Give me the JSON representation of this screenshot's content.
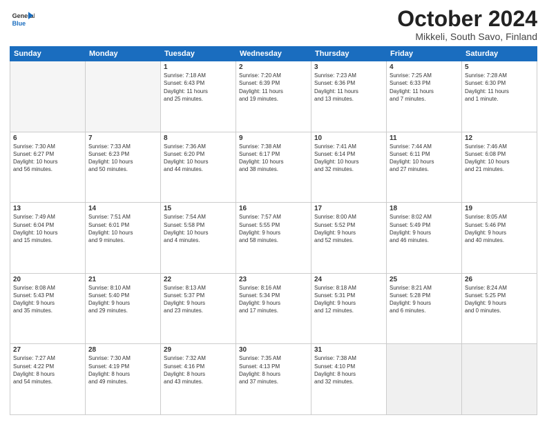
{
  "logo": {
    "line1": "General",
    "line2": "Blue"
  },
  "title": "October 2024",
  "subtitle": "Mikkeli, South Savo, Finland",
  "weekdays": [
    "Sunday",
    "Monday",
    "Tuesday",
    "Wednesday",
    "Thursday",
    "Friday",
    "Saturday"
  ],
  "weeks": [
    [
      {
        "day": "",
        "detail": ""
      },
      {
        "day": "",
        "detail": ""
      },
      {
        "day": "1",
        "detail": "Sunrise: 7:18 AM\nSunset: 6:43 PM\nDaylight: 11 hours\nand 25 minutes."
      },
      {
        "day": "2",
        "detail": "Sunrise: 7:20 AM\nSunset: 6:39 PM\nDaylight: 11 hours\nand 19 minutes."
      },
      {
        "day": "3",
        "detail": "Sunrise: 7:23 AM\nSunset: 6:36 PM\nDaylight: 11 hours\nand 13 minutes."
      },
      {
        "day": "4",
        "detail": "Sunrise: 7:25 AM\nSunset: 6:33 PM\nDaylight: 11 hours\nand 7 minutes."
      },
      {
        "day": "5",
        "detail": "Sunrise: 7:28 AM\nSunset: 6:30 PM\nDaylight: 11 hours\nand 1 minute."
      }
    ],
    [
      {
        "day": "6",
        "detail": "Sunrise: 7:30 AM\nSunset: 6:27 PM\nDaylight: 10 hours\nand 56 minutes."
      },
      {
        "day": "7",
        "detail": "Sunrise: 7:33 AM\nSunset: 6:23 PM\nDaylight: 10 hours\nand 50 minutes."
      },
      {
        "day": "8",
        "detail": "Sunrise: 7:36 AM\nSunset: 6:20 PM\nDaylight: 10 hours\nand 44 minutes."
      },
      {
        "day": "9",
        "detail": "Sunrise: 7:38 AM\nSunset: 6:17 PM\nDaylight: 10 hours\nand 38 minutes."
      },
      {
        "day": "10",
        "detail": "Sunrise: 7:41 AM\nSunset: 6:14 PM\nDaylight: 10 hours\nand 32 minutes."
      },
      {
        "day": "11",
        "detail": "Sunrise: 7:44 AM\nSunset: 6:11 PM\nDaylight: 10 hours\nand 27 minutes."
      },
      {
        "day": "12",
        "detail": "Sunrise: 7:46 AM\nSunset: 6:08 PM\nDaylight: 10 hours\nand 21 minutes."
      }
    ],
    [
      {
        "day": "13",
        "detail": "Sunrise: 7:49 AM\nSunset: 6:04 PM\nDaylight: 10 hours\nand 15 minutes."
      },
      {
        "day": "14",
        "detail": "Sunrise: 7:51 AM\nSunset: 6:01 PM\nDaylight: 10 hours\nand 9 minutes."
      },
      {
        "day": "15",
        "detail": "Sunrise: 7:54 AM\nSunset: 5:58 PM\nDaylight: 10 hours\nand 4 minutes."
      },
      {
        "day": "16",
        "detail": "Sunrise: 7:57 AM\nSunset: 5:55 PM\nDaylight: 9 hours\nand 58 minutes."
      },
      {
        "day": "17",
        "detail": "Sunrise: 8:00 AM\nSunset: 5:52 PM\nDaylight: 9 hours\nand 52 minutes."
      },
      {
        "day": "18",
        "detail": "Sunrise: 8:02 AM\nSunset: 5:49 PM\nDaylight: 9 hours\nand 46 minutes."
      },
      {
        "day": "19",
        "detail": "Sunrise: 8:05 AM\nSunset: 5:46 PM\nDaylight: 9 hours\nand 40 minutes."
      }
    ],
    [
      {
        "day": "20",
        "detail": "Sunrise: 8:08 AM\nSunset: 5:43 PM\nDaylight: 9 hours\nand 35 minutes."
      },
      {
        "day": "21",
        "detail": "Sunrise: 8:10 AM\nSunset: 5:40 PM\nDaylight: 9 hours\nand 29 minutes."
      },
      {
        "day": "22",
        "detail": "Sunrise: 8:13 AM\nSunset: 5:37 PM\nDaylight: 9 hours\nand 23 minutes."
      },
      {
        "day": "23",
        "detail": "Sunrise: 8:16 AM\nSunset: 5:34 PM\nDaylight: 9 hours\nand 17 minutes."
      },
      {
        "day": "24",
        "detail": "Sunrise: 8:18 AM\nSunset: 5:31 PM\nDaylight: 9 hours\nand 12 minutes."
      },
      {
        "day": "25",
        "detail": "Sunrise: 8:21 AM\nSunset: 5:28 PM\nDaylight: 9 hours\nand 6 minutes."
      },
      {
        "day": "26",
        "detail": "Sunrise: 8:24 AM\nSunset: 5:25 PM\nDaylight: 9 hours\nand 0 minutes."
      }
    ],
    [
      {
        "day": "27",
        "detail": "Sunrise: 7:27 AM\nSunset: 4:22 PM\nDaylight: 8 hours\nand 54 minutes."
      },
      {
        "day": "28",
        "detail": "Sunrise: 7:30 AM\nSunset: 4:19 PM\nDaylight: 8 hours\nand 49 minutes."
      },
      {
        "day": "29",
        "detail": "Sunrise: 7:32 AM\nSunset: 4:16 PM\nDaylight: 8 hours\nand 43 minutes."
      },
      {
        "day": "30",
        "detail": "Sunrise: 7:35 AM\nSunset: 4:13 PM\nDaylight: 8 hours\nand 37 minutes."
      },
      {
        "day": "31",
        "detail": "Sunrise: 7:38 AM\nSunset: 4:10 PM\nDaylight: 8 hours\nand 32 minutes."
      },
      {
        "day": "",
        "detail": ""
      },
      {
        "day": "",
        "detail": ""
      }
    ]
  ]
}
